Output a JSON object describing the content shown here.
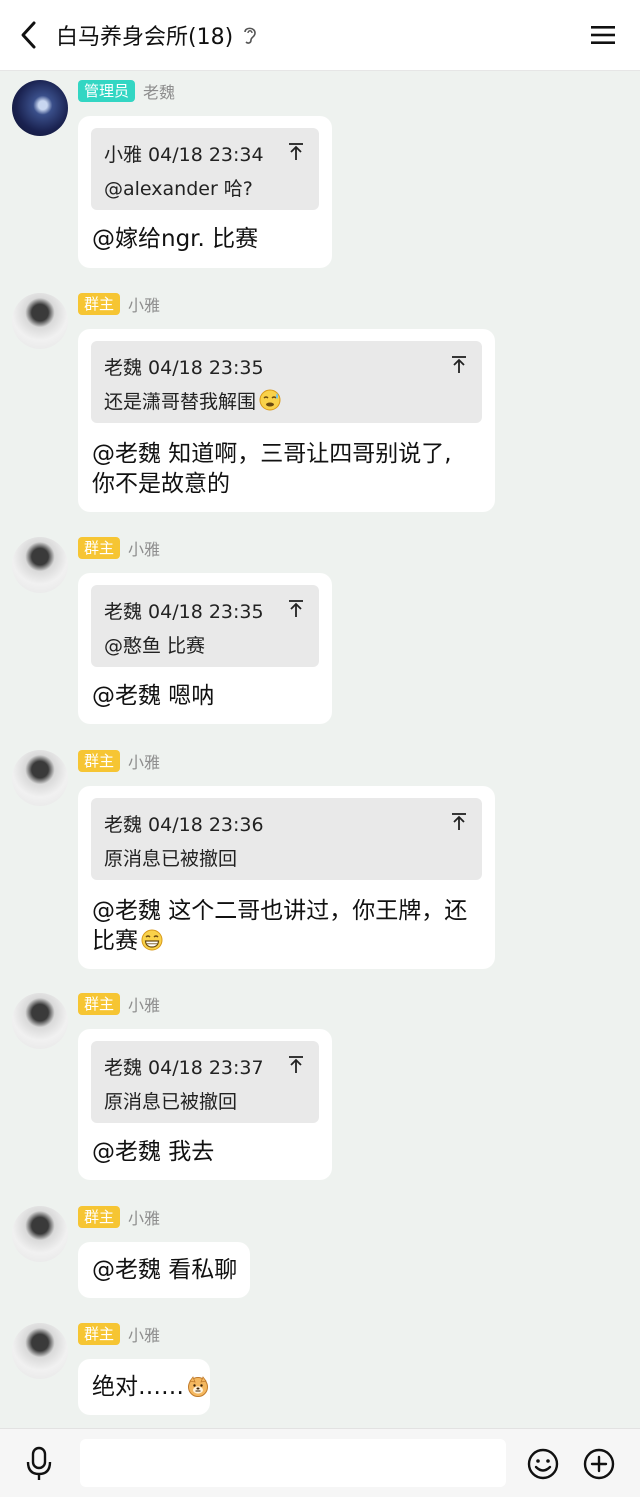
{
  "header": {
    "title": "白马养身会所(18)"
  },
  "messages": [
    {
      "role": "管理员",
      "sender": "老魏",
      "quote": {
        "head": "小雅 04/18 23:34",
        "text": "@alexander 哈?"
      },
      "lines": [
        "@嫁给ngr. 比赛"
      ]
    },
    {
      "role": "群主",
      "sender": "小雅",
      "quote": {
        "head": "老魏 04/18 23:35",
        "text": "还是潇哥替我解围"
      },
      "lines": [
        "@老魏 知道啊，三哥让四哥别说了,",
        "你不是故意的"
      ]
    },
    {
      "role": "群主",
      "sender": "小雅",
      "quote": {
        "head": "老魏 04/18 23:35",
        "text": "@憨鱼 比赛"
      },
      "lines": [
        "@老魏 嗯呐"
      ]
    },
    {
      "role": "群主",
      "sender": "小雅",
      "quote": {
        "head": "老魏 04/18 23:36",
        "text": "原消息已被撤回"
      },
      "lines": [
        "@老魏 这个二哥也讲过，你王牌，还",
        "比赛"
      ]
    },
    {
      "role": "群主",
      "sender": "小雅",
      "quote": {
        "head": "老魏 04/18 23:37",
        "text": "原消息已被撤回"
      },
      "lines": [
        "@老魏 我去"
      ]
    },
    {
      "role": "群主",
      "sender": "小雅",
      "lines": [
        "@老魏 看私聊"
      ]
    },
    {
      "role": "群主",
      "sender": "小雅",
      "lines": [
        "绝对……"
      ]
    }
  ],
  "input": {
    "placeholder": ""
  },
  "icons": {
    "back": "chevron-left-icon",
    "ear": "ear-icon",
    "menu": "menu-icon",
    "pin": "arrow-to-top-icon",
    "mic": "microphone-icon",
    "emoji": "smiley-icon",
    "plus": "plus-circle-icon"
  },
  "colors": {
    "admin_badge": "#33d6c3",
    "owner_badge": "#f6c533",
    "background": "#eef2ef"
  }
}
